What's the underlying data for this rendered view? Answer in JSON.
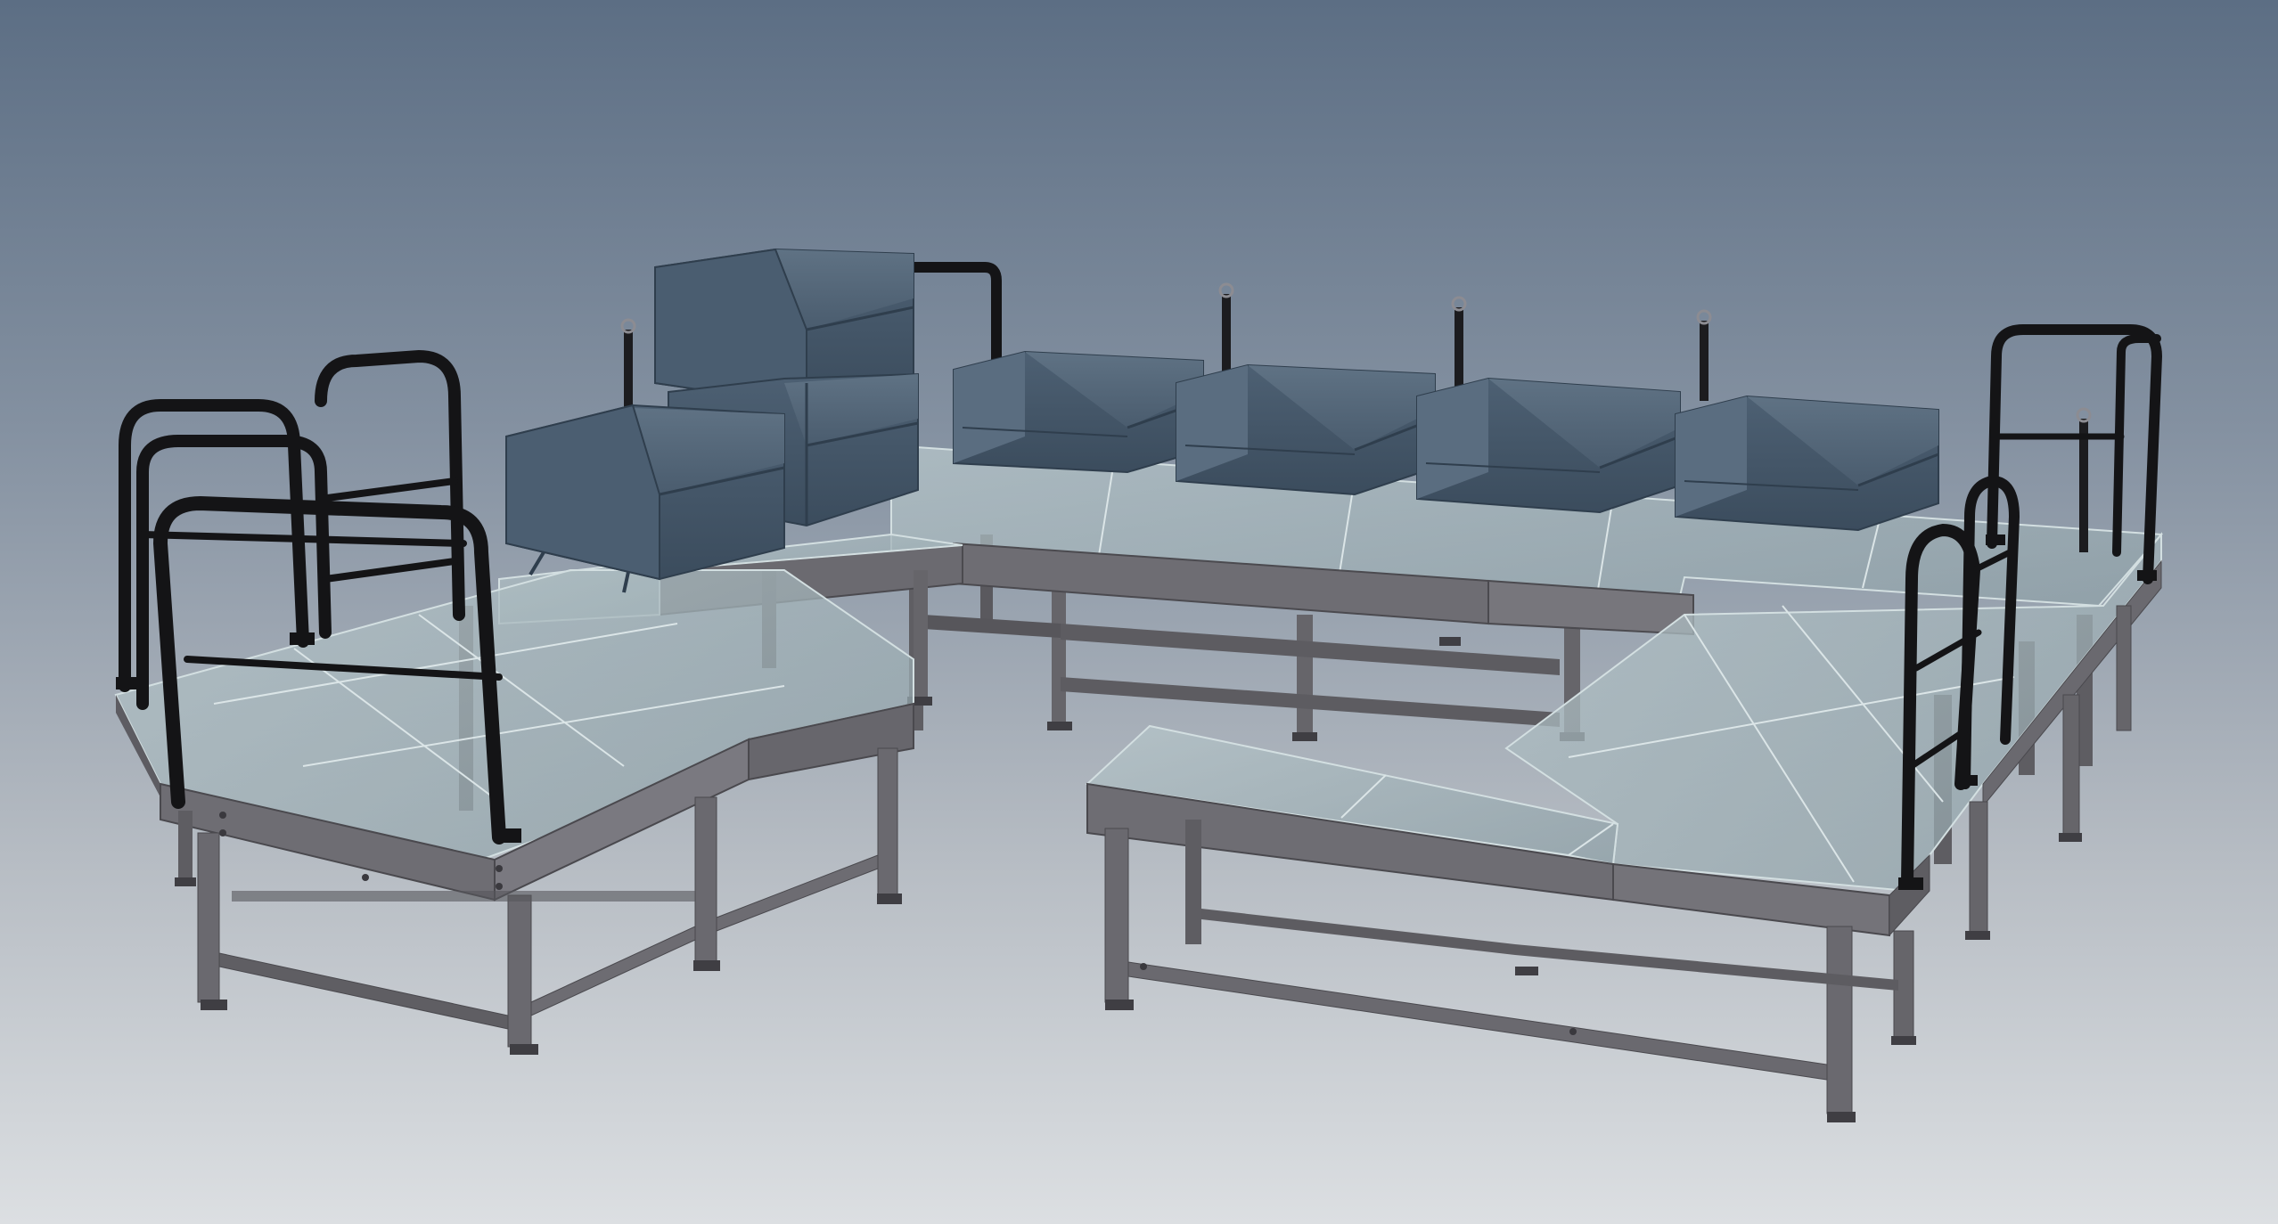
{
  "viewport": {
    "kind": "cad-3d-view",
    "background_top": "#5c6e84",
    "background_bottom": "#dcdfe2"
  },
  "model": {
    "description_visible_text": "",
    "colors": {
      "frame": "#6c6b70",
      "frame_dark": "#47464b",
      "frame_light": "#8a8990",
      "glass": "#9fb2b8",
      "glass_edge": "#c9d6d8",
      "bin": "#44576a",
      "bin_dark": "#2f3e4d",
      "bin_light": "#5b6e80",
      "railing": "#141416"
    },
    "components": {
      "bins": 7,
      "eye_bolt_posts": 5,
      "guard_rails": 4,
      "platform_modules": 3
    }
  }
}
